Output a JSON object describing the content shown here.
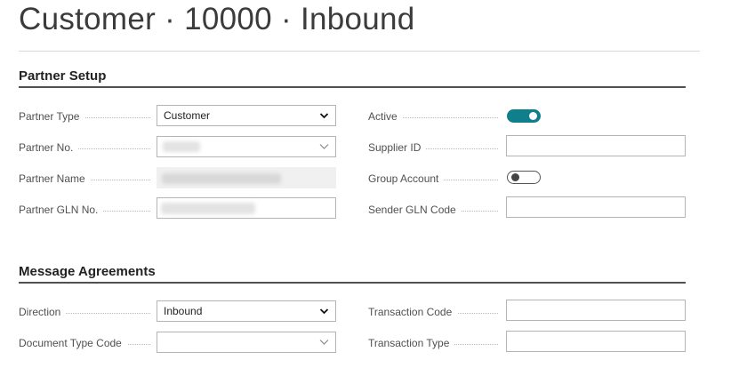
{
  "page": {
    "title": "Customer · 10000 · Inbound"
  },
  "partner_setup": {
    "header": "Partner Setup",
    "partner_type": {
      "label": "Partner Type",
      "value": "Customer"
    },
    "partner_no": {
      "label": "Partner No.",
      "value": ""
    },
    "partner_name": {
      "label": "Partner Name",
      "value": ""
    },
    "partner_gln_no": {
      "label": "Partner GLN No.",
      "value": ""
    },
    "active": {
      "label": "Active",
      "value": true
    },
    "supplier_id": {
      "label": "Supplier ID",
      "value": ""
    },
    "group_account": {
      "label": "Group Account",
      "value": false
    },
    "sender_gln_code": {
      "label": "Sender GLN Code",
      "value": ""
    }
  },
  "message_agreements": {
    "header": "Message Agreements",
    "direction": {
      "label": "Direction",
      "value": "Inbound"
    },
    "document_type_code": {
      "label": "Document Type Code",
      "value": ""
    },
    "transaction_code": {
      "label": "Transaction Code",
      "value": ""
    },
    "transaction_type": {
      "label": "Transaction Type",
      "value": ""
    }
  },
  "icons": {
    "dropdown": "chevron-down-icon"
  },
  "colors": {
    "toggle_on": "#0f7f8c",
    "section_rule": "#505050"
  }
}
